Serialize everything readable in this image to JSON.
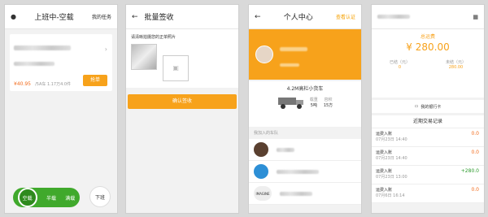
{
  "colors": {
    "accent": "#f7a21b",
    "price": "#f26b1c",
    "green": "#40a92c"
  },
  "panel1": {
    "title": "上班中-空载",
    "right": "我的任务",
    "card": {
      "price": "¥40.95",
      "meta": "/5A车 1.17万4.0件",
      "action": "抢单"
    },
    "toggle": [
      "空载",
      "半载",
      "满载"
    ],
    "off_work": "下班"
  },
  "panel2": {
    "title": "批量签收",
    "hint": "请清晰拍摄您的正单照片",
    "confirm": "确认签收"
  },
  "panel3": {
    "title": "个人中心",
    "right": "查看认证",
    "truck_name": "4.2M高栏小货车",
    "load_label": "载重",
    "load_value": "5吨",
    "volume_label": "容积",
    "volume_value": "15方",
    "teams_label": "我加入的车队",
    "team3_name": "IMAGINE"
  },
  "panel4": {
    "total_label": "总运费",
    "total_value": "¥ 280.00",
    "settled_label": "已结（元）",
    "settled_value": "0",
    "unsettled_label": "未结（元）",
    "unsettled_value": "280.00",
    "bank": "我的银行卡",
    "records_title": "近期交易记录",
    "records": [
      {
        "label": "运费入账",
        "date": "07月23日 14:40",
        "amount": "0.0"
      },
      {
        "label": "运费入账",
        "date": "07月23日 14:40",
        "amount": "0.0"
      },
      {
        "label": "运费入账",
        "date": "07月23日 13:00",
        "amount": "+280.0"
      },
      {
        "label": "运费入账",
        "date": "07月6日 16:14",
        "amount": "0.0"
      }
    ]
  }
}
